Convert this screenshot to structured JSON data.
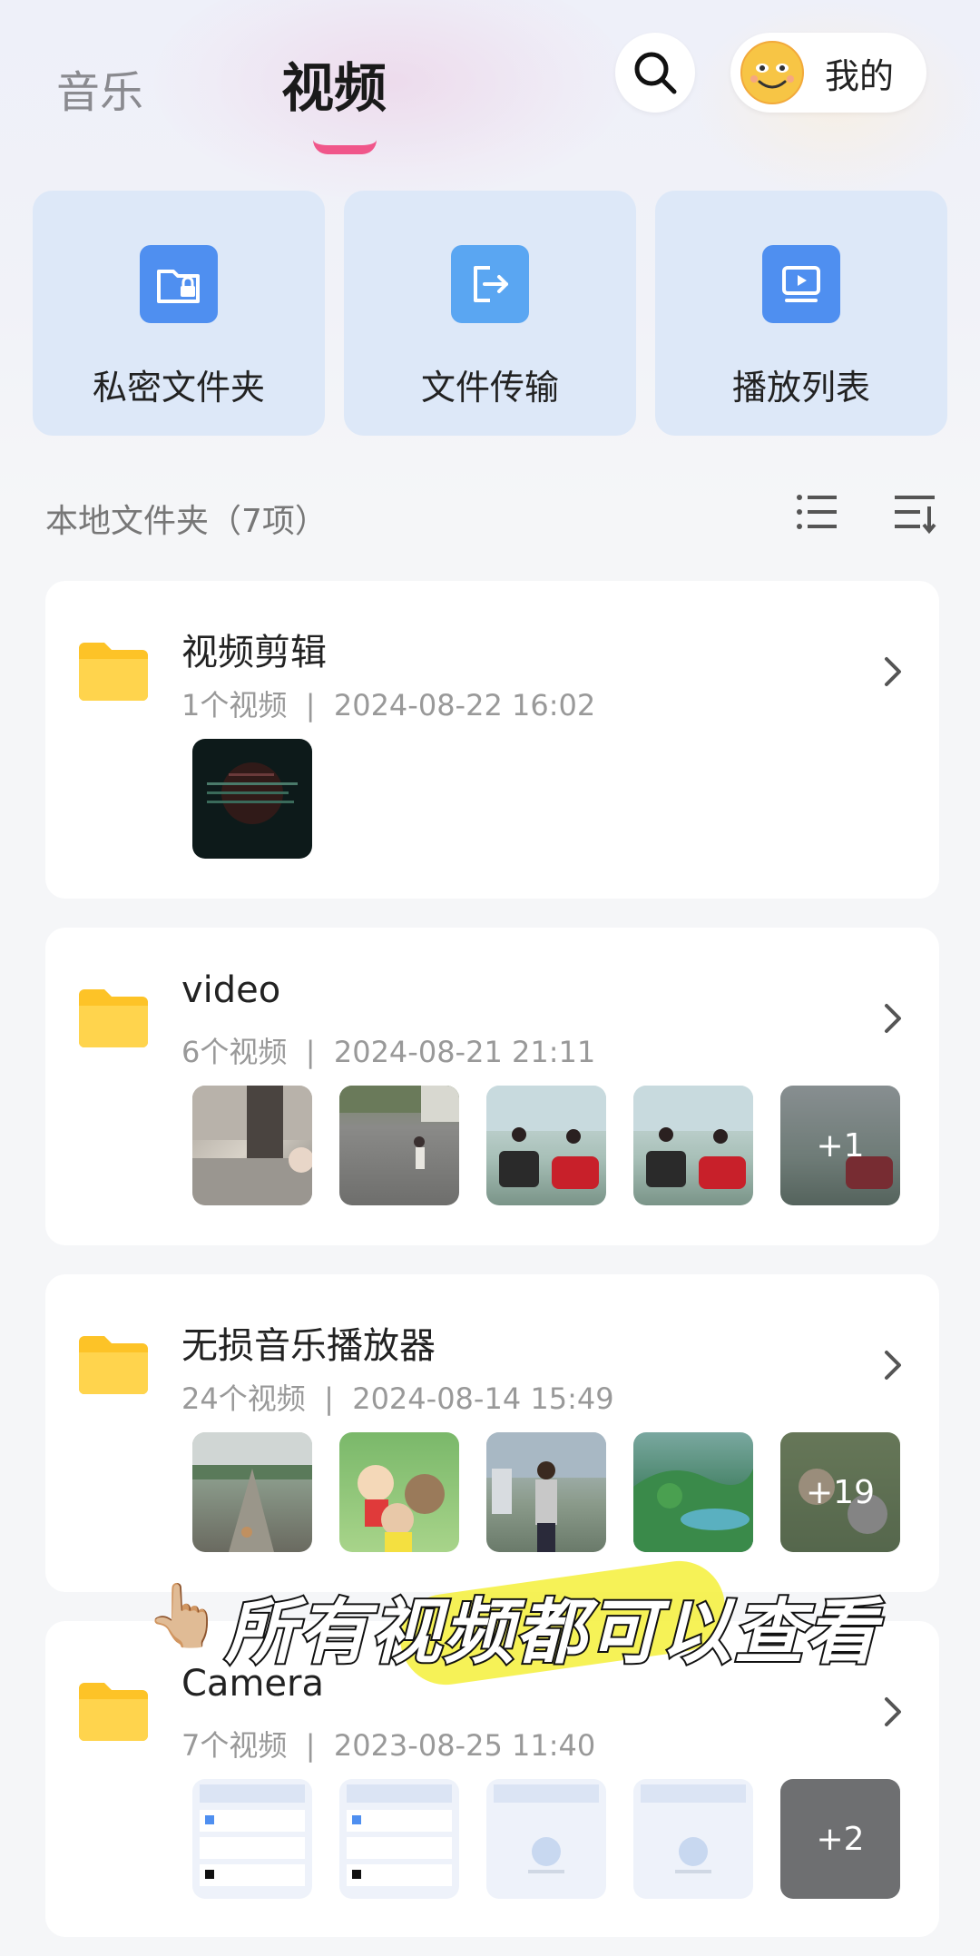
{
  "header": {
    "tab_music": "音乐",
    "tab_video": "视频",
    "mine_label": "我的"
  },
  "quick_actions": [
    {
      "label": "私密文件夹",
      "icon": "private-folder-lock-icon"
    },
    {
      "label": "文件传输",
      "icon": "file-transfer-icon"
    },
    {
      "label": "播放列表",
      "icon": "playlist-icon"
    }
  ],
  "section": {
    "title": "本地文件夹（7项）"
  },
  "folders": [
    {
      "name": "视频剪辑",
      "count": "1个视频",
      "date": "2024-08-22 16:02",
      "more": ""
    },
    {
      "name": "video",
      "count": "6个视频",
      "date": "2024-08-21 21:11",
      "more": "+1"
    },
    {
      "name": "无损音乐播放器",
      "count": "24个视频",
      "date": "2024-08-14 15:49",
      "more": "+19"
    },
    {
      "name": "Camera",
      "count": "7个视频",
      "date": "2023-08-25 11:40",
      "more": "+2"
    }
  ],
  "caption": {
    "text": "所有视频都可以查看",
    "hand": "👆🏼"
  },
  "colors": {
    "accent_pink": "#f0568a",
    "quick_card_bg": "#dde8f8",
    "quick_icon_blue": "#4f8ff0",
    "folder_yellow": "#fdc327"
  }
}
